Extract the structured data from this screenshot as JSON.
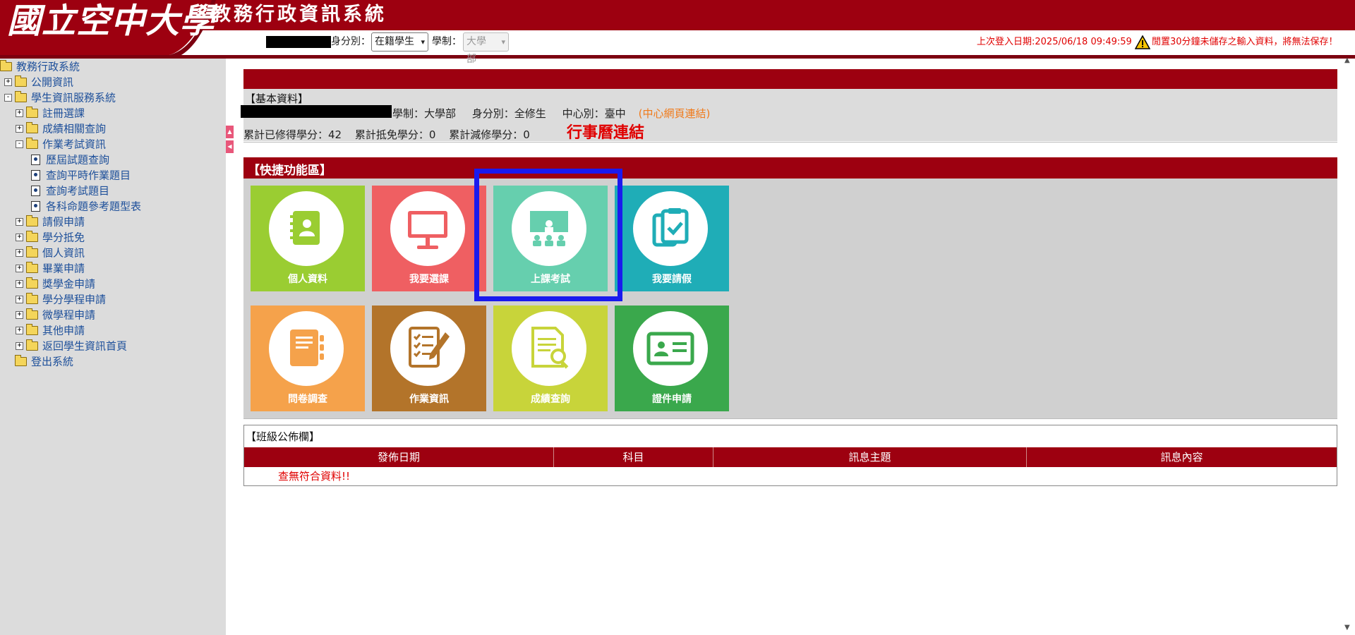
{
  "header": {
    "logo_text": "國立空中大學",
    "system_title": "教務行政資訊系統",
    "identity_label": "身分別：",
    "identity_value": "在籍學生",
    "school_label": "學制：",
    "school_value": "大學部",
    "last_login": "上次登入日期:2025/06/18 09:49:59",
    "warning": "閒置30分鐘未儲存之輸入資料，將無法保存！",
    "brand_color": "#9d0010"
  },
  "sidebar": {
    "items": [
      {
        "label": "教務行政系統",
        "level": 0,
        "type": "folder-open"
      },
      {
        "label": "公開資訊",
        "level": 1,
        "type": "folder",
        "toggle": "+"
      },
      {
        "label": "學生資訊服務系統",
        "level": 1,
        "type": "folder-open",
        "toggle": "-"
      },
      {
        "label": "註冊選課",
        "level": 2,
        "type": "folder",
        "toggle": "+"
      },
      {
        "label": "成績相關查詢",
        "level": 2,
        "type": "folder",
        "toggle": "+"
      },
      {
        "label": "作業考試資訊",
        "level": 2,
        "type": "folder-open",
        "toggle": "-"
      },
      {
        "label": "歷屆試題查詢",
        "level": 3,
        "type": "doc"
      },
      {
        "label": "查詢平時作業題目",
        "level": 3,
        "type": "doc"
      },
      {
        "label": "查詢考試題目",
        "level": 3,
        "type": "doc"
      },
      {
        "label": "各科命題參考題型表",
        "level": 3,
        "type": "doc"
      },
      {
        "label": "請假申請",
        "level": 2,
        "type": "folder",
        "toggle": "+"
      },
      {
        "label": "學分抵免",
        "level": 2,
        "type": "folder",
        "toggle": "+"
      },
      {
        "label": "個人資訊",
        "level": 2,
        "type": "folder",
        "toggle": "+"
      },
      {
        "label": "畢業申請",
        "level": 2,
        "type": "folder",
        "toggle": "+"
      },
      {
        "label": "獎學金申請",
        "level": 2,
        "type": "folder",
        "toggle": "+"
      },
      {
        "label": "學分學程申請",
        "level": 2,
        "type": "folder",
        "toggle": "+"
      },
      {
        "label": "微學程申請",
        "level": 2,
        "type": "folder",
        "toggle": "+"
      },
      {
        "label": "其他申請",
        "level": 2,
        "type": "folder",
        "toggle": "+"
      },
      {
        "label": "返回學生資訊首頁",
        "level": 2,
        "type": "folder",
        "toggle": "+"
      },
      {
        "label": "登出系統",
        "level": 1,
        "type": "folder"
      }
    ]
  },
  "basic_info": {
    "title": "【基本資料】",
    "school_system": "學制：大學部",
    "identity": "身分別：全修生",
    "center": "中心別：臺中",
    "center_link": "(中心網頁連結)",
    "credits_earned": "累計已修得學分：42",
    "credits_waived": "累計抵免學分：0",
    "credits_reduced": "累計減修學分：0",
    "calendar_link": "行事曆連結"
  },
  "quick": {
    "title": "【快捷功能區】",
    "tiles": [
      {
        "label": "個人資料",
        "color": "#9acd32",
        "icon": "address-book-icon"
      },
      {
        "label": "我要選課",
        "color": "#ef5f62",
        "icon": "monitor-icon"
      },
      {
        "label": "上課考試",
        "color": "#66cfae",
        "icon": "classroom-icon"
      },
      {
        "label": "我要請假",
        "color": "#1fadb7",
        "icon": "clipboard-check-icon"
      },
      {
        "label": "問卷調查",
        "color": "#f5a24b",
        "icon": "notebook-icon"
      },
      {
        "label": "作業資訊",
        "color": "#b3742a",
        "icon": "checklist-pen-icon"
      },
      {
        "label": "成績查詢",
        "color": "#c8d43a",
        "icon": "document-search-icon"
      },
      {
        "label": "證件申請",
        "color": "#3aa84c",
        "icon": "id-card-icon"
      }
    ]
  },
  "announcements": {
    "title": "【班級公佈欄】",
    "columns": [
      "發佈日期",
      "科目",
      "訊息主題",
      "訊息內容"
    ],
    "empty_message": "查無符合資料!!"
  }
}
